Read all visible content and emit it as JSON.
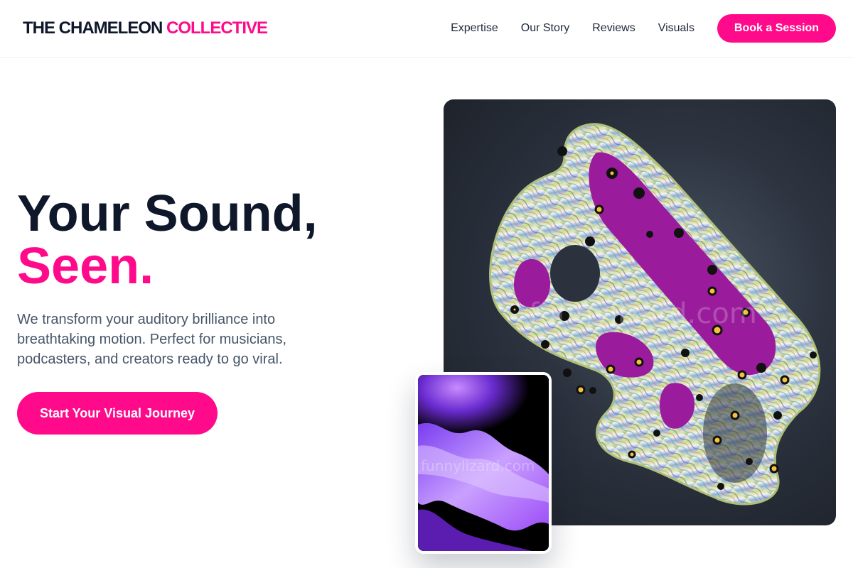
{
  "brand": {
    "name_main": "THE CHAMELEON",
    "name_accent": "COLLECTIVE"
  },
  "nav": {
    "items": [
      "Expertise",
      "Our Story",
      "Reviews",
      "Visuals"
    ],
    "cta_label": "Book a Session"
  },
  "hero": {
    "title_line1": "Your Sound,",
    "title_line2": "Seen.",
    "description": "We transform your auditory brilliance into breathtaking motion. Perfect for musicians, podcasters, and creators ready to go viral.",
    "cta_label": "Start Your Visual Journey"
  },
  "visuals": {
    "main_image": "abstract-3d-sculpture-image",
    "secondary_image": "purple-smoke-image",
    "watermark": "funnylizard.com"
  },
  "colors": {
    "accent": "#ff0a8a",
    "text_dark": "#0f172a",
    "text_muted": "#475569"
  }
}
